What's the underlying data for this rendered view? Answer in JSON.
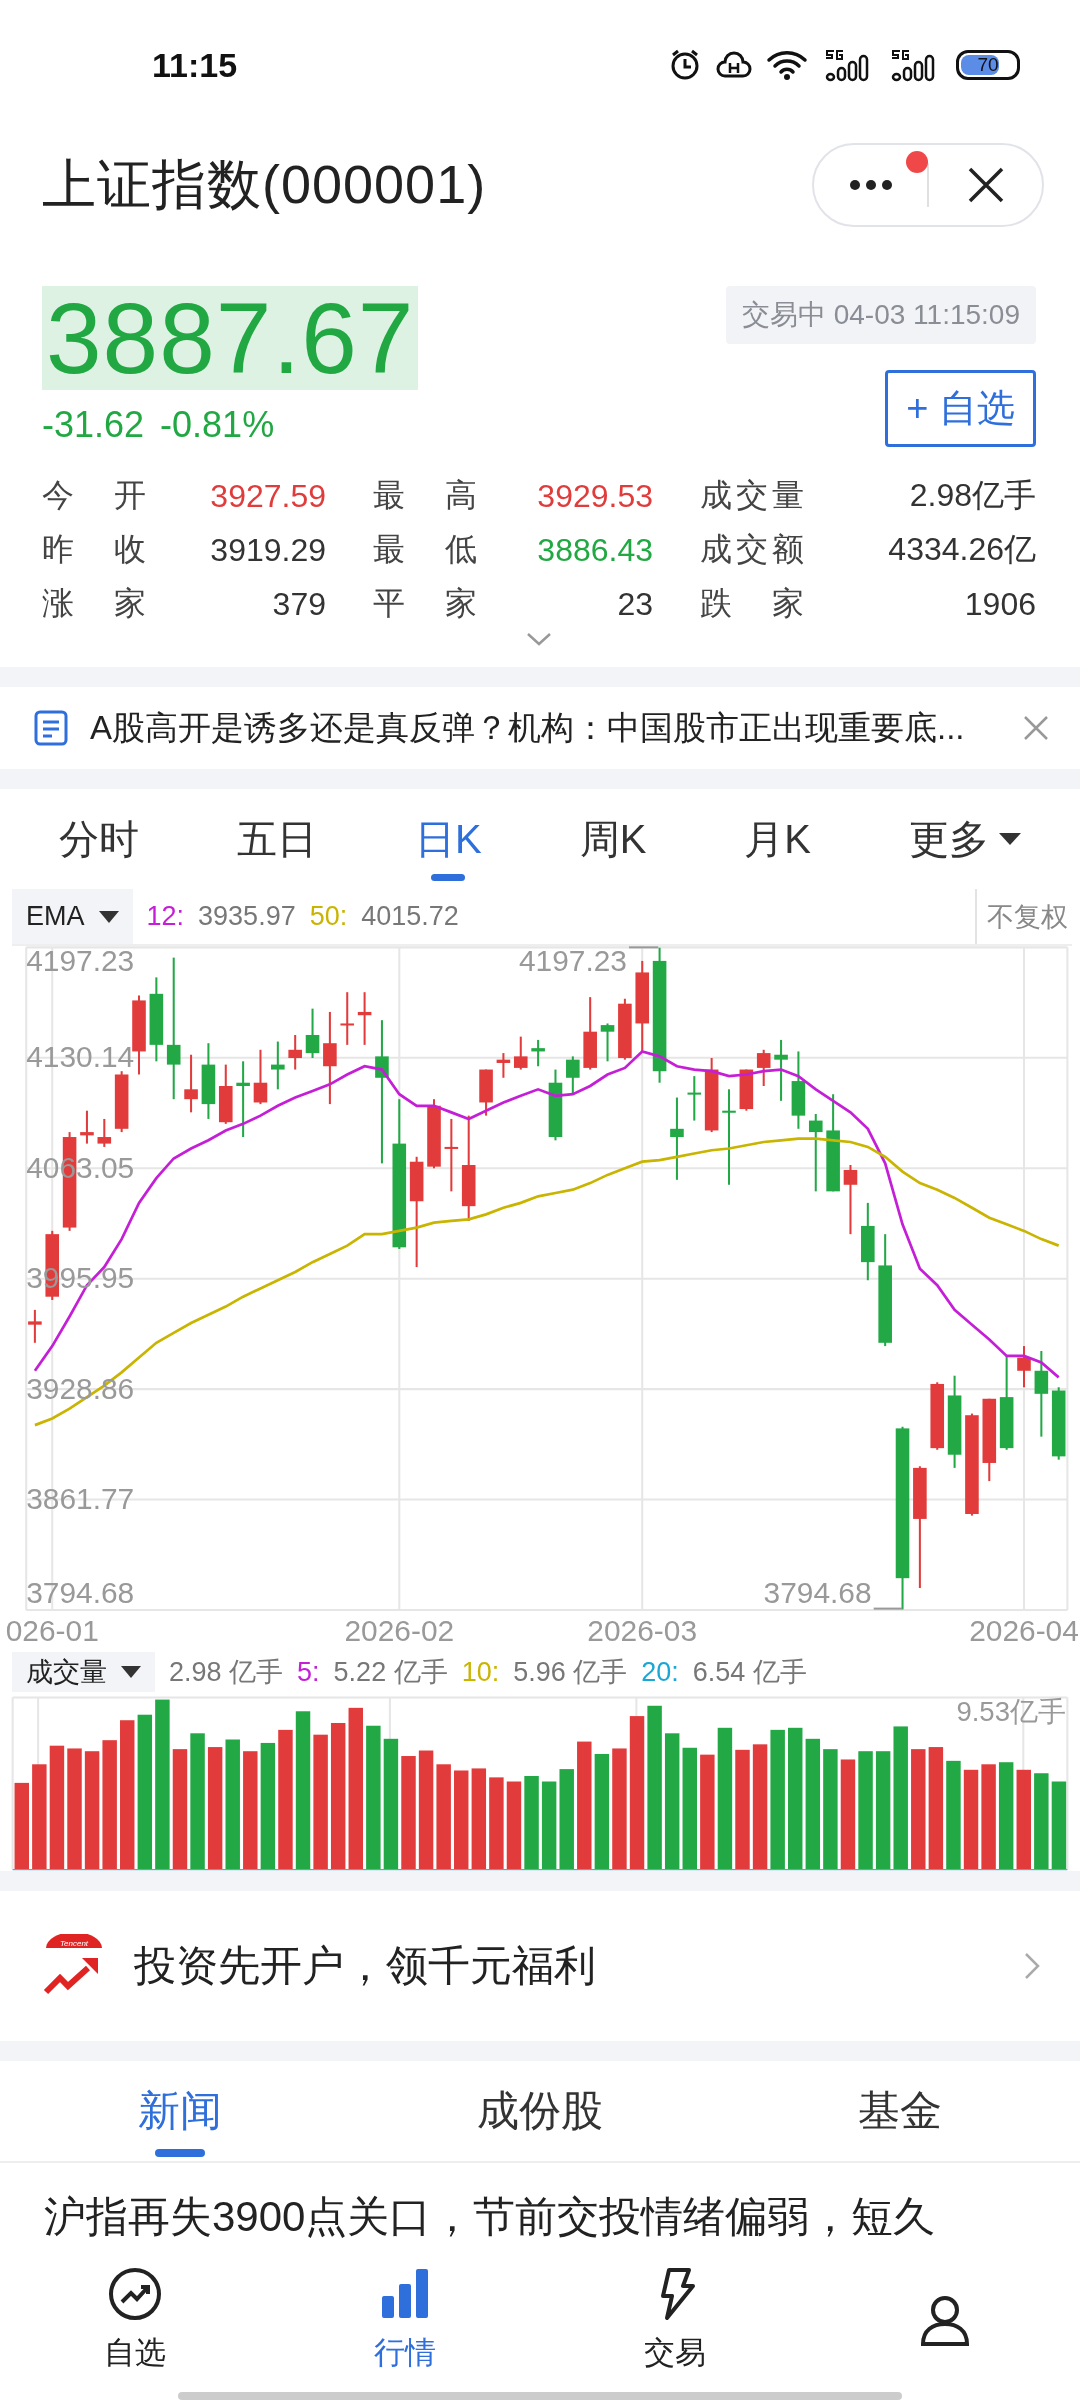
{
  "status_bar": {
    "time": "11:15",
    "battery": "70"
  },
  "header": {
    "title": "上证指数(000001)",
    "menu_badge": true
  },
  "quote": {
    "price": "3887.67",
    "color": "#21a843",
    "change": "-31.62",
    "change_pct": "-0.81%",
    "status": "交易中 04-03 11:15:09",
    "watch_button": "+ 自选"
  },
  "stats": [
    [
      {
        "label": "今 开",
        "value": "3927.59",
        "color": "#e03c3c"
      },
      {
        "label": "最 高",
        "value": "3929.53",
        "color": "#e03c3c"
      },
      {
        "label": "成交量",
        "value": "2.98亿手",
        "color": "#333333"
      }
    ],
    [
      {
        "label": "昨 收",
        "value": "3919.29",
        "color": "#333333"
      },
      {
        "label": "最 低",
        "value": "3886.43",
        "color": "#21a843"
      },
      {
        "label": "成交额",
        "value": "4334.26亿",
        "color": "#333333"
      }
    ],
    [
      {
        "label": "涨 家",
        "value": "379",
        "color": "#333333"
      },
      {
        "label": "平 家",
        "value": "23",
        "color": "#333333"
      },
      {
        "label": "跌 家",
        "value": "1906",
        "color": "#333333"
      }
    ]
  ],
  "ticker": {
    "text": "A股高开是诱多还是真反弹？机构：中国股市正出现重要底..."
  },
  "periods": [
    {
      "label": "分时",
      "selected": false,
      "kind": "tab"
    },
    {
      "label": "五日",
      "selected": false,
      "kind": "tab"
    },
    {
      "label": "日K",
      "selected": true,
      "kind": "tab"
    },
    {
      "label": "周K",
      "selected": false,
      "kind": "tab"
    },
    {
      "label": "月K",
      "selected": false,
      "kind": "tab"
    },
    {
      "label": "更多",
      "selected": false,
      "kind": "menu"
    }
  ],
  "chart": {
    "indicator": "EMA",
    "adjust": "不复权",
    "ema": [
      {
        "value": "3935.97"
      },
      {
        "value": "4015.72"
      }
    ],
    "high_mark": "4197.23",
    "low_mark": "3794.68",
    "chart_data": {
      "type": "candlestick",
      "grid": true,
      "ylim": [
        3794.68,
        4197.23
      ],
      "categories": [
        null,
        "026-01",
        null,
        null,
        null,
        null,
        null,
        null,
        null,
        null,
        null,
        null,
        null,
        null,
        null,
        null,
        null,
        null,
        null,
        null,
        null,
        "2026-02",
        null,
        null,
        null,
        null,
        null,
        null,
        null,
        null,
        null,
        null,
        null,
        null,
        null,
        "2026-03",
        null,
        null,
        null,
        null,
        null,
        null,
        null,
        null,
        null,
        null,
        null,
        null,
        null,
        null,
        null,
        null,
        null,
        null,
        null,
        null,
        null,
        "2026-04",
        null,
        null
      ],
      "ohlc": [
        [
          3968,
          3977,
          3957,
          3970
        ],
        [
          3985,
          4025,
          3983,
          4023
        ],
        [
          4027,
          4085,
          4025,
          4082
        ],
        [
          4083,
          4098,
          4078,
          4085
        ],
        [
          4078,
          4093,
          4076,
          4082
        ],
        [
          4087,
          4122,
          4085,
          4120
        ],
        [
          4134,
          4168,
          4120,
          4165
        ],
        [
          4169,
          4179,
          4128,
          4138
        ],
        [
          4138,
          4191,
          4105,
          4126
        ],
        [
          4105,
          4132,
          4097,
          4111
        ],
        [
          4126,
          4139,
          4093,
          4102
        ],
        [
          4091,
          4126,
          4090,
          4113
        ],
        [
          4115,
          4128,
          4082,
          4113
        ],
        [
          4103,
          4135,
          4102,
          4115
        ],
        [
          4126,
          4140,
          4111,
          4123
        ],
        [
          4130,
          4144,
          4123,
          4135
        ],
        [
          4144,
          4160,
          4130,
          4133
        ],
        [
          4125,
          4158,
          4102,
          4139
        ],
        [
          4150,
          4170,
          4138,
          4151
        ],
        [
          4156,
          4170,
          4138,
          4158
        ],
        [
          4131,
          4153,
          4066,
          4118
        ],
        [
          4078,
          4105,
          4014,
          4015
        ],
        [
          4043,
          4070,
          4003,
          4067
        ],
        [
          4064,
          4105,
          4063,
          4101
        ],
        [
          4075,
          4093,
          4049,
          4076
        ],
        [
          4040,
          4095,
          4031,
          4065
        ],
        [
          4103,
          4123,
          4095,
          4123
        ],
        [
          4127,
          4133,
          4118,
          4129
        ],
        [
          4124,
          4143,
          4123,
          4131
        ],
        [
          4136,
          4141,
          4125,
          4134
        ],
        [
          4115,
          4123,
          4080,
          4082
        ],
        [
          4129,
          4131,
          4108,
          4118
        ],
        [
          4124,
          4167,
          4123,
          4146
        ],
        [
          4150,
          4151,
          4128,
          4146
        ],
        [
          4130,
          4166,
          4129,
          4163
        ],
        [
          4151,
          4189,
          4134,
          4182
        ],
        [
          4189,
          4197,
          4115,
          4122
        ],
        [
          4087,
          4106,
          4056,
          4082
        ],
        [
          4109,
          4119,
          4092,
          4108
        ],
        [
          4086,
          4130,
          4085,
          4123
        ],
        [
          4098,
          4111,
          4053,
          4097
        ],
        [
          4099,
          4123,
          4098,
          4123
        ],
        [
          4124,
          4135,
          4113,
          4133
        ],
        [
          4132,
          4141,
          4104,
          4129
        ],
        [
          4116,
          4134,
          4087,
          4095
        ],
        [
          4092,
          4096,
          4049,
          4085
        ],
        [
          4086,
          4108,
          4049,
          4049
        ],
        [
          4053,
          4065,
          4023,
          4062
        ],
        [
          4028,
          4042,
          3995,
          4006
        ],
        [
          4004,
          4023,
          3955,
          3957
        ],
        [
          3905,
          3906,
          3795,
          3814
        ],
        [
          3850,
          3882,
          3808,
          3881
        ],
        [
          3893,
          3933,
          3892,
          3932
        ],
        [
          3925,
          3937,
          3881,
          3889
        ],
        [
          3853,
          3914,
          3852,
          3913
        ],
        [
          3884,
          3923,
          3873,
          3923
        ],
        [
          3924,
          3949,
          3892,
          3893
        ],
        [
          3940,
          3955,
          3930,
          3948
        ],
        [
          3940,
          3952,
          3900,
          3926
        ],
        [
          3928,
          3930,
          3886,
          3888
        ]
      ],
      "yticks": [
        {
          "value": 4197.23,
          "label": "4197.23"
        },
        {
          "value": 4130.14,
          "label": "4130.14"
        },
        {
          "value": 4063.05,
          "label": "4063.05"
        },
        {
          "value": 3995.95,
          "label": "3995.95"
        },
        {
          "value": 3928.86,
          "label": "3928.86"
        },
        {
          "value": 3861.77,
          "label": "3861.77"
        },
        {
          "value": 3794.68,
          "label": "3794.68"
        }
      ],
      "series": [
        {
          "name": "12:",
          "type": "line",
          "color": "#c41fd6",
          "values": [
            3940,
            3955,
            3973,
            3992,
            4003,
            4020,
            4042,
            4057,
            4069,
            4075,
            4080,
            4086,
            4090,
            4095,
            4101,
            4106,
            4110,
            4114,
            4120,
            4125,
            4123,
            4108,
            4101,
            4101,
            4097,
            4093,
            4098,
            4103,
            4107,
            4111,
            4107,
            4108,
            4113,
            4120,
            4124,
            4134,
            4131,
            4125,
            4123,
            4122,
            4119,
            4120,
            4122,
            4123,
            4119,
            4111,
            4104,
            4097,
            4087,
            4066,
            4029,
            4002,
            3992,
            3977,
            3968,
            3959,
            3949,
            3949,
            3945,
            3936
          ]
        },
        {
          "name": "50:",
          "type": "line",
          "color": "#c9b400",
          "values": [
            3907,
            3911,
            3917,
            3924,
            3931,
            3939,
            3948,
            3957,
            3963,
            3969,
            3974,
            3979,
            3985,
            3990,
            3995,
            4000,
            4006,
            4011,
            4016,
            4023,
            4023,
            4025,
            4027,
            4030,
            4031,
            4032,
            4035,
            4039,
            4042,
            4046,
            4048,
            4050,
            4054,
            4059,
            4063,
            4067,
            4068,
            4070,
            4072,
            4074,
            4075,
            4077,
            4079,
            4080,
            4081,
            4081,
            4080,
            4079,
            4076,
            4070,
            4061,
            4054,
            4050,
            4045,
            4039,
            4033,
            4029,
            4025,
            4020,
            4016
          ]
        }
      ]
    }
  },
  "volume": {
    "indicator": "成交量",
    "current": "2.98 亿手",
    "ma": [
      {
        "label": "5:",
        "value": "5.22 亿手",
        "color": "#c41fd6"
      },
      {
        "label": "10:",
        "value": "5.96 亿手",
        "color": "#c9b400"
      },
      {
        "label": "20:",
        "value": "6.54 亿手",
        "color": "#1aa6d6"
      }
    ],
    "max_label": "9.53亿手"
  },
  "promo": {
    "logo_text": "Tencent",
    "text": "投资先开户，领千元福利"
  },
  "info_tabs": [
    {
      "label": "新闻",
      "selected": true
    },
    {
      "label": "成份股",
      "selected": false
    },
    {
      "label": "基金",
      "selected": false
    }
  ],
  "news": [
    {
      "headline": "沪指再失3900点关口，节前交投情绪偏弱，短久"
    }
  ],
  "nav": [
    {
      "label": "自选",
      "kind": "trend",
      "selected": false
    },
    {
      "label": "行情",
      "kind": "bars",
      "selected": true
    },
    {
      "label": "交易",
      "kind": "bolt",
      "selected": false
    },
    {
      "kind": "person",
      "selected": false
    }
  ]
}
